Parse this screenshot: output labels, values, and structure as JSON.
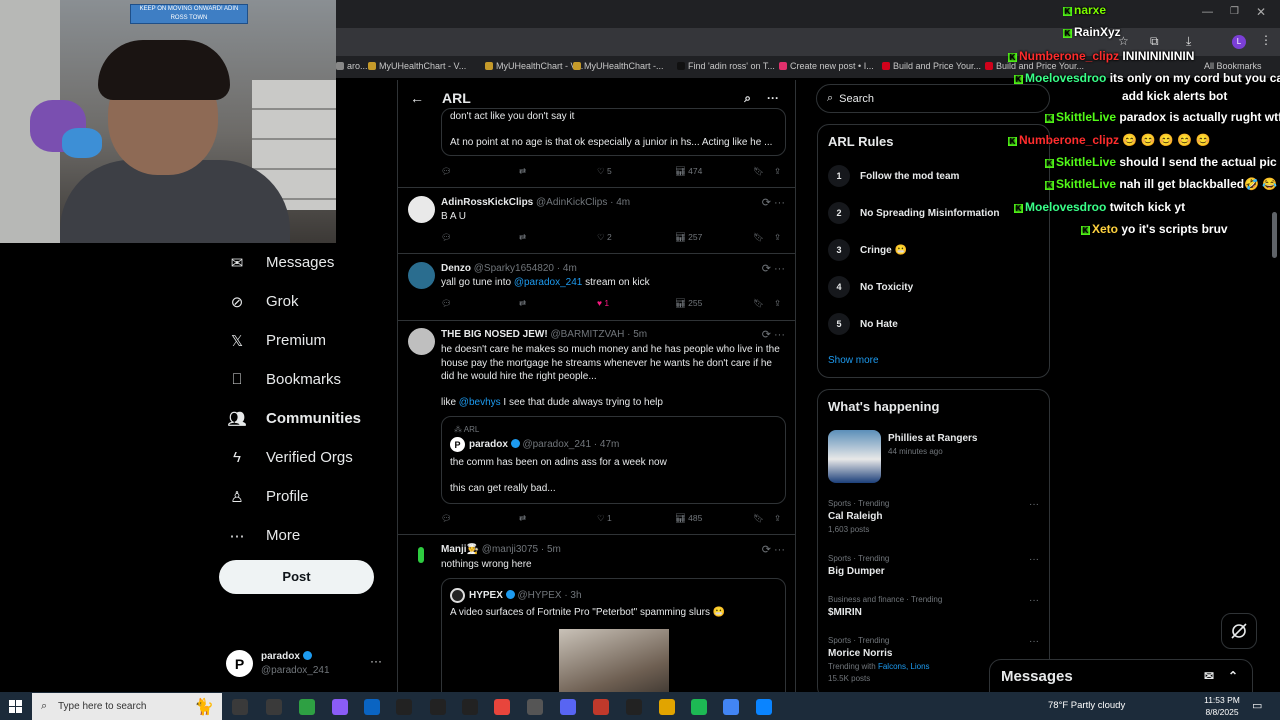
{
  "stream_overlay": {
    "banner_text": "KEEP ON MOVING ONWARD! ADIN ROSS TOWN",
    "chat": [
      {
        "user": "narxe",
        "user_color": "#7CFC00",
        "message": ""
      },
      {
        "user": "RainXyz",
        "user_color": "#ffffff",
        "message": ""
      },
      {
        "user": "Numberone_clipz",
        "user_color": "#ff2d2d",
        "message": "ININININININ"
      },
      {
        "user": "Moelovesdroo",
        "user_color": "#39ff88",
        "message": "its only on my cord but you ca"
      },
      {
        "user": "",
        "user_color": "#ffffff",
        "message": "add kick alerts bot"
      },
      {
        "user": "SkittleLive",
        "user_color": "#53fc18",
        "message": "paradox is actually rught wtf"
      },
      {
        "user": "Numberone_clipz",
        "user_color": "#ff2d2d",
        "message": "😊 😊 😊 😊 😊"
      },
      {
        "user": "SkittleLive",
        "user_color": "#53fc18",
        "message": "should I send the actual pic of"
      },
      {
        "user": "SkittleLive",
        "user_color": "#53fc18",
        "message": "nah ill get blackballed🤣 😂 😂"
      },
      {
        "user": "Moelovesdroo",
        "user_color": "#39ff88",
        "message": "twitch kick yt"
      },
      {
        "user": "Xeto",
        "user_color": "#ffd23f",
        "message": "yo it's scripts bruv"
      }
    ]
  },
  "browser": {
    "bookmarks": [
      {
        "label": "aro...",
        "color": "#888"
      },
      {
        "label": "MyUHealthChart - V...",
        "color": "#c59a2a"
      },
      {
        "label": "MyUHealthChart - V...",
        "color": "#c59a2a"
      },
      {
        "label": "MyUHealthChart -...",
        "color": "#c59a2a"
      },
      {
        "label": "Find 'adin ross' on T...",
        "color": "#111"
      },
      {
        "label": "Create new post • I...",
        "color": "#e1306c"
      },
      {
        "label": "Build and Price Your...",
        "color": "#d0021b"
      },
      {
        "label": "Build and Price Your...",
        "color": "#d0021b"
      }
    ],
    "all_bookmarks": "All Bookmarks"
  },
  "nav": {
    "items": [
      {
        "label": "Messages",
        "icon": "mail-icon",
        "bold": false
      },
      {
        "label": "Grok",
        "icon": "grok-icon",
        "bold": false
      },
      {
        "label": "Premium",
        "icon": "x-logo-icon",
        "bold": false
      },
      {
        "label": "Bookmarks",
        "icon": "bookmark-icon",
        "bold": false
      },
      {
        "label": "Communities",
        "icon": "people-icon",
        "bold": true
      },
      {
        "label": "Verified Orgs",
        "icon": "lightning-icon",
        "bold": false
      },
      {
        "label": "Profile",
        "icon": "person-icon",
        "bold": false
      },
      {
        "label": "More",
        "icon": "more-circle-icon",
        "bold": false
      }
    ],
    "post_label": "Post",
    "account": {
      "name": "paradox",
      "handle": "@paradox_241",
      "initial": "P",
      "more": "···"
    }
  },
  "feed": {
    "title": "ARL",
    "tweets": [
      {
        "partial_text_1": "don't act like you don't say it",
        "partial_text_2": "At no point at no age is that ok especially a junior in hs... Acting like he ...",
        "likes": "5",
        "views": "474"
      },
      {
        "name": "AdinRossKickClips",
        "handle": "@AdinKickClips",
        "time": "· 4m",
        "text": "B A U",
        "likes": "2",
        "views": "257"
      },
      {
        "name": "Denzo",
        "handle": "@Sparky1654820",
        "time": "· 4m",
        "text_pre": "yall go tune into ",
        "mention": "@paradox_241",
        "text_post": " stream on kick",
        "likes": "1",
        "views": "255"
      },
      {
        "name": "THE BIG NOSED JEW!",
        "handle": "@BARMITZVAH",
        "time": "· 5m",
        "text": "he doesn't care he makes so much money and he has people who live in the house pay the mortgage he streams whenever he wants he don't care if he did he would hire the right people...",
        "like_pre": "like ",
        "like_mention": "@bevhys",
        "like_post": " I see that dude always trying to help",
        "quote": {
          "community": "ARL",
          "name": "paradox",
          "handle": "@paradox_241",
          "time": "· 47m",
          "line1": "the comm has been on adins ass for a week now",
          "line2": "this can get really bad..."
        },
        "likes": "1",
        "views": "485"
      },
      {
        "name": "Manji🧑‍🍳",
        "handle": "@manji3075",
        "time": "· 5m",
        "text": "nothings wrong here",
        "quote": {
          "name": "HYPEX",
          "handle": "@HYPEX",
          "time": "· 3h",
          "text": "A video surfaces of Fortnite Pro \"Peterbot\" spamming slurs 😬"
        }
      }
    ]
  },
  "sidebar": {
    "search_placeholder": "Search",
    "rules_title": "ARL Rules",
    "rules": [
      {
        "n": "1",
        "label": "Follow the mod team"
      },
      {
        "n": "2",
        "label": "No Spreading Misinformation"
      },
      {
        "n": "3",
        "label": "Cringe 😬"
      },
      {
        "n": "4",
        "label": "No Toxicity"
      },
      {
        "n": "5",
        "label": "No Hate"
      }
    ],
    "show_more": "Show more",
    "happening_title": "What's happening",
    "featured": {
      "name": "Phillies at Rangers",
      "meta": "44 minutes ago"
    },
    "trends": [
      {
        "meta": "Sports · Trending",
        "name": "Cal Raleigh",
        "count": "1,603 posts"
      },
      {
        "meta": "Sports · Trending",
        "name": "Big Dumper",
        "count": ""
      },
      {
        "meta": "Business and finance · Trending",
        "name": "$MIRIN",
        "count": ""
      },
      {
        "meta": "Sports · Trending",
        "name": "Morice Norris",
        "with_pre": "Trending with ",
        "with_links": "Falcons, Lions",
        "count": "15.5K posts"
      }
    ]
  },
  "messages_drawer": {
    "label": "Messages"
  },
  "taskbar": {
    "search_placeholder": "Type here to search",
    "weather": "78°F  Partly cloudy",
    "time": "11:53 PM",
    "date": "8/8/2025"
  }
}
